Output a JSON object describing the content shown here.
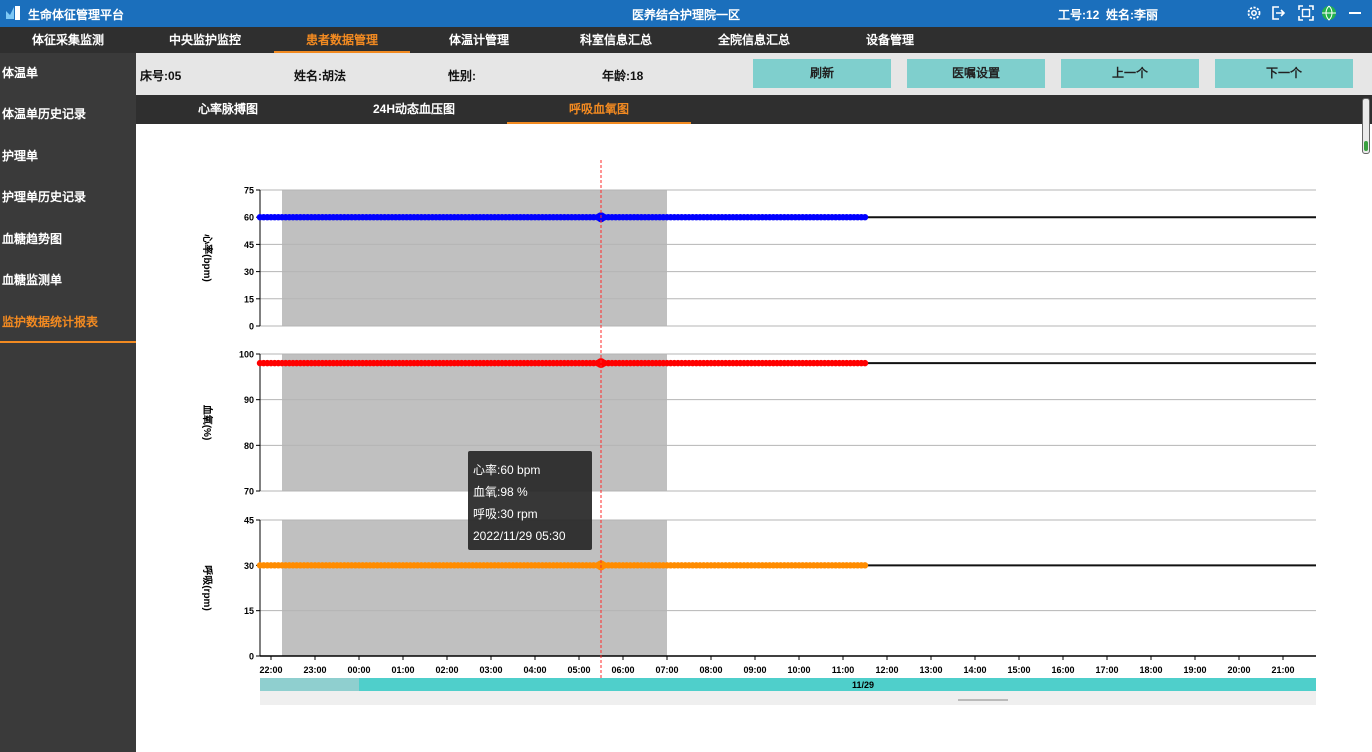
{
  "titlebar": {
    "app_title": "生命体征管理平台",
    "center_title": "医养结合护理院一区",
    "user_id": "工号:12",
    "user_name": "姓名:李丽",
    "icons": [
      "logo-icon",
      "settings-icon",
      "logout-icon",
      "screenshot-icon",
      "globe-icon",
      "minimize-icon"
    ]
  },
  "nav": {
    "items": [
      {
        "label": "体征采集监测"
      },
      {
        "label": "中央监护监控"
      },
      {
        "label": "患者数据管理"
      },
      {
        "label": "体温计管理"
      },
      {
        "label": "科室信息汇总"
      },
      {
        "label": "全院信息汇总"
      },
      {
        "label": "设备管理"
      }
    ],
    "active_index": 2
  },
  "sidebar": {
    "items": [
      {
        "label": "体温单"
      },
      {
        "label": "体温单历史记录"
      },
      {
        "label": "护理单"
      },
      {
        "label": "护理单历史记录"
      },
      {
        "label": "血糖趋势图"
      },
      {
        "label": "血糖监测单"
      },
      {
        "label": "监护数据统计报表"
      }
    ],
    "active_index": 6
  },
  "patient": {
    "bed": "床号:05",
    "name": "姓名:胡法",
    "gender": "性别:",
    "age": "年龄:18"
  },
  "actions": {
    "refresh": "刷新",
    "doctor_settings": "医嘱设置",
    "prev": "上一个",
    "next": "下一个"
  },
  "subtabs": {
    "items": [
      {
        "label": "心率脉搏图"
      },
      {
        "label": "24H动态血压图"
      },
      {
        "label": "呼吸血氧图"
      }
    ],
    "active_index": 2
  },
  "tooltip": {
    "hr": "心率:60 bpm",
    "spo2": "血氧:98 %",
    "resp": "呼吸:30 rpm",
    "time": "2022/11/29 05:30"
  },
  "colors": {
    "accent": "#f28a21",
    "titlebar": "#1b6fbc",
    "button": "#7fcfcd",
    "hr_series": "#0000ff",
    "spo2_series": "#ff0000",
    "resp_series": "#ff8c00",
    "shade": "#c0c0c0",
    "slider": "#4fcfcb"
  },
  "chart_data": [
    {
      "type": "line",
      "ylabel": "心率(bpm)",
      "ylim": [
        0,
        75
      ],
      "yticks": [
        0,
        15,
        30,
        45,
        60,
        75
      ],
      "series": [
        {
          "values": [
            60
          ]
        }
      ],
      "value": 60,
      "data_start": "21:45",
      "data_end": "11:30",
      "interval_min": 5,
      "shaded_range": [
        "22:15",
        "07:00"
      ],
      "cursor": "05:30"
    },
    {
      "type": "line",
      "ylabel": "血氧(%)",
      "ylim": [
        70,
        100
      ],
      "yticks": [
        70,
        80,
        90,
        100
      ],
      "series": [
        {
          "values": [
            98
          ]
        }
      ],
      "value": 98,
      "data_start": "21:45",
      "data_end": "11:30",
      "interval_min": 5,
      "shaded_range": [
        "22:15",
        "07:00"
      ],
      "cursor": "05:30"
    },
    {
      "type": "line",
      "ylabel": "呼吸(rpm)",
      "ylim": [
        0,
        45
      ],
      "yticks": [
        0,
        15,
        30,
        45
      ],
      "series": [
        {
          "values": [
            30
          ]
        }
      ],
      "value": 30,
      "data_start": "21:45",
      "data_end": "11:30",
      "interval_min": 5,
      "shaded_range": [
        "22:15",
        "07:00"
      ],
      "cursor": "05:30"
    }
  ],
  "x_axis": {
    "start": "21:45",
    "end": "21:45",
    "ticks": [
      "22:00",
      "23:00",
      "00:00",
      "01:00",
      "02:00",
      "03:00",
      "04:00",
      "05:00",
      "06:00",
      "07:00",
      "08:00",
      "09:00",
      "10:00",
      "11:00",
      "12:00",
      "13:00",
      "14:00",
      "15:00",
      "16:00",
      "17:00",
      "18:00",
      "19:00",
      "20:00",
      "21:00"
    ],
    "date_label": "11/29"
  }
}
